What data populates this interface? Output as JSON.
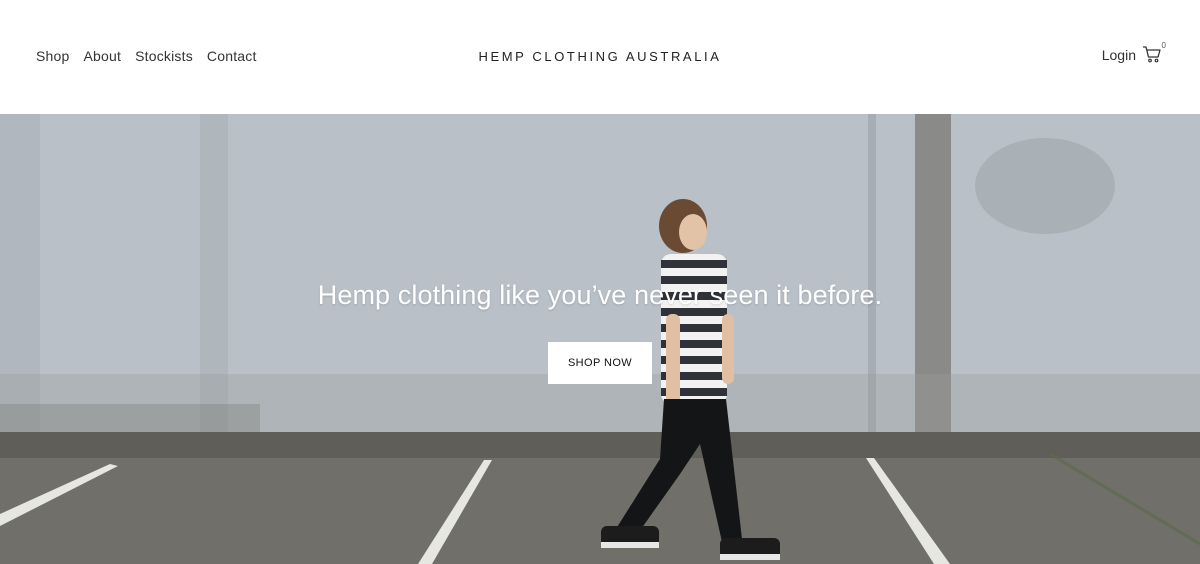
{
  "header": {
    "nav_items": [
      "Shop",
      "About",
      "Stockists",
      "Contact"
    ],
    "brand": "HEMP CLOTHING AUSTRALIA",
    "login": "Login",
    "cart_count": "0",
    "icons": {
      "cart": "shopping-cart-icon"
    }
  },
  "hero": {
    "headline": "Hemp clothing like you’ve never seen it before.",
    "cta_label": "SHOP NOW"
  },
  "colors": {
    "header_bg": "#ffffff",
    "wall": "#b7bec6",
    "ground": "#6e6d68",
    "cta_bg": "#ffffff"
  }
}
